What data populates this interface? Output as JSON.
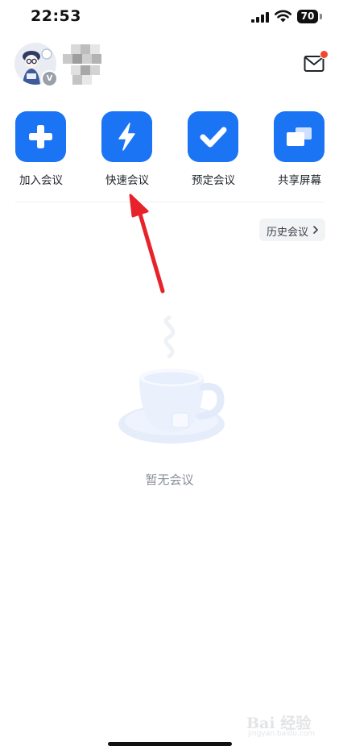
{
  "status_bar": {
    "time": "22:53",
    "battery": "70"
  },
  "header": {
    "avatar_icon": "user-avatar",
    "verified_icon": "v-badge-icon",
    "badge_text": "V",
    "mail_icon": "mail-icon",
    "notification_color": "#f2462d"
  },
  "actions": [
    {
      "label": "加入会议",
      "icon": "plus-icon"
    },
    {
      "label": "快速会议",
      "icon": "lightning-icon"
    },
    {
      "label": "预定会议",
      "icon": "check-icon"
    },
    {
      "label": "共享屏幕",
      "icon": "share-screen-icon"
    }
  ],
  "history_button": {
    "label": "历史会议",
    "icon": "chevron-right-icon"
  },
  "empty_state": {
    "text": "暂无会议",
    "icon": "coffee-cup-illustration"
  },
  "annotation": {
    "icon": "red-arrow",
    "color": "#e8222b"
  },
  "watermark": {
    "main": "Bai 经验",
    "sub": "jingyan.baidu.com"
  },
  "theme": {
    "accent": "#1a74f4"
  }
}
